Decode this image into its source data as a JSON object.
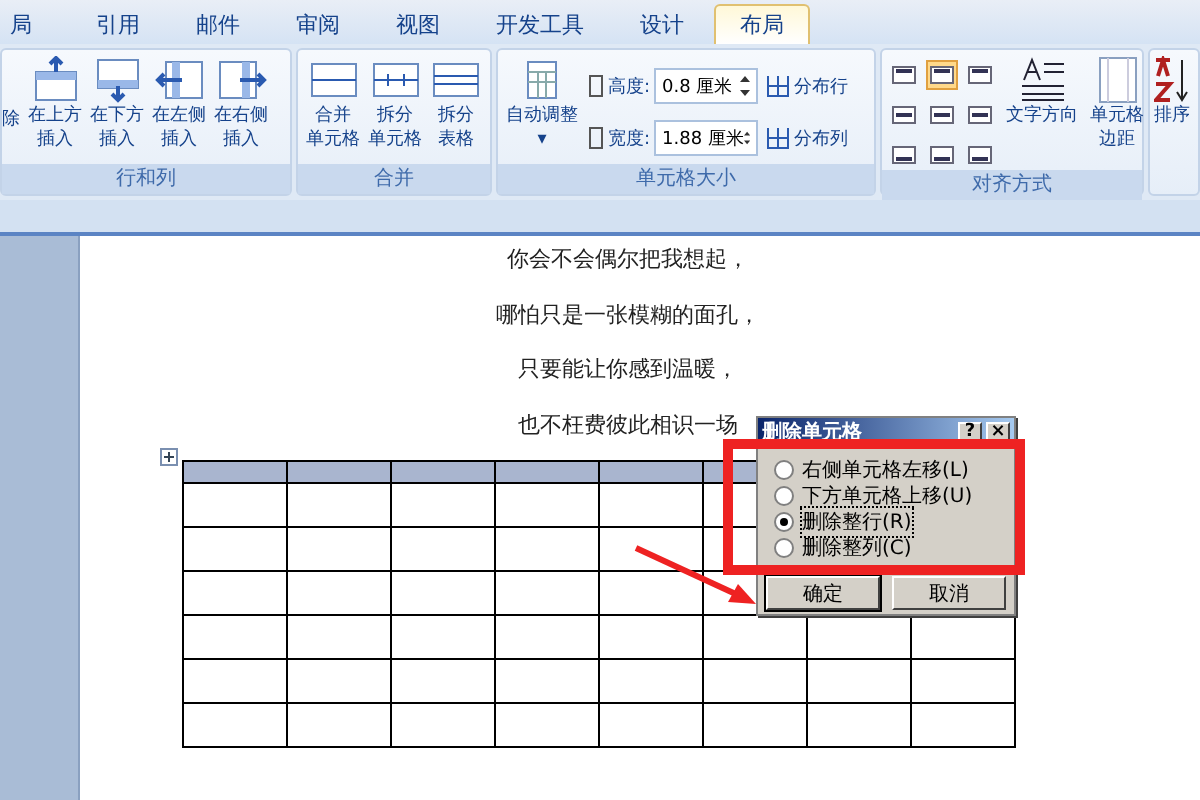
{
  "tabs": [
    {
      "label": "局",
      "selected": false
    },
    {
      "label": "引用",
      "selected": false
    },
    {
      "label": "邮件",
      "selected": false
    },
    {
      "label": "审阅",
      "selected": false
    },
    {
      "label": "视图",
      "selected": false
    },
    {
      "label": "开发工具",
      "selected": false
    },
    {
      "label": "设计",
      "selected": false
    },
    {
      "label": "布局",
      "selected": true
    }
  ],
  "ribbon": {
    "partial_button": "除",
    "rows_columns": {
      "title": "行和列",
      "buttons": [
        {
          "line1": "在上方",
          "line2": "插入",
          "kind": "above"
        },
        {
          "line1": "在下方",
          "line2": "插入",
          "kind": "below"
        },
        {
          "line1": "在左侧",
          "line2": "插入",
          "kind": "left"
        },
        {
          "line1": "在右侧",
          "line2": "插入",
          "kind": "right"
        }
      ]
    },
    "merge": {
      "title": "合并",
      "buttons": [
        {
          "line1": "合并",
          "line2": "单元格"
        },
        {
          "line1": "拆分",
          "line2": "单元格"
        },
        {
          "line1": "拆分",
          "line2": "表格"
        }
      ]
    },
    "cell_size": {
      "title": "单元格大小",
      "autofit": "自动调整",
      "autofit_caret": "▾",
      "fields": [
        {
          "label": "高度:",
          "value": "0.8 厘米"
        },
        {
          "label": "宽度:",
          "value": "1.88 厘米"
        }
      ],
      "distribute": [
        "分布行",
        "分布列"
      ]
    },
    "alignment": {
      "title": "对齐方式",
      "cells": [
        {
          "selected": false
        },
        {
          "selected": true
        },
        {
          "selected": false
        },
        {
          "selected": false
        },
        {
          "selected": false
        },
        {
          "selected": false
        },
        {
          "selected": false
        },
        {
          "selected": false
        },
        {
          "selected": false
        }
      ],
      "buttons": [
        {
          "line1": "文字方向",
          "kind": "direction"
        },
        {
          "line1": "单元格",
          "line2": "边距",
          "kind": "margins"
        }
      ]
    },
    "partial_sort": "排序"
  },
  "document": {
    "lines": [
      "你会不会偶尔把我想起，",
      "哪怕只是一张模糊的面孔，",
      "只要能让你感到温暖，",
      "也不枉费彼此相识一场"
    ],
    "table": {
      "rows": [
        {
          "selected": true
        },
        {
          "selected": false
        },
        {
          "selected": false
        },
        {
          "selected": false
        },
        {
          "selected": false
        },
        {
          "selected": false
        },
        {
          "selected": false
        }
      ]
    }
  },
  "dialog": {
    "title": "删除单元格",
    "help": "?",
    "close": "×",
    "options": [
      {
        "label": "右侧单元格左移(L)",
        "selected": false
      },
      {
        "label": "下方单元格上移(U)",
        "selected": false
      },
      {
        "label": "删除整行(R)",
        "selected": true
      },
      {
        "label": "删除整列(C)",
        "selected": false
      }
    ],
    "buttons": [
      {
        "label": "确定",
        "default": true
      },
      {
        "label": "取消",
        "default": false
      }
    ]
  }
}
